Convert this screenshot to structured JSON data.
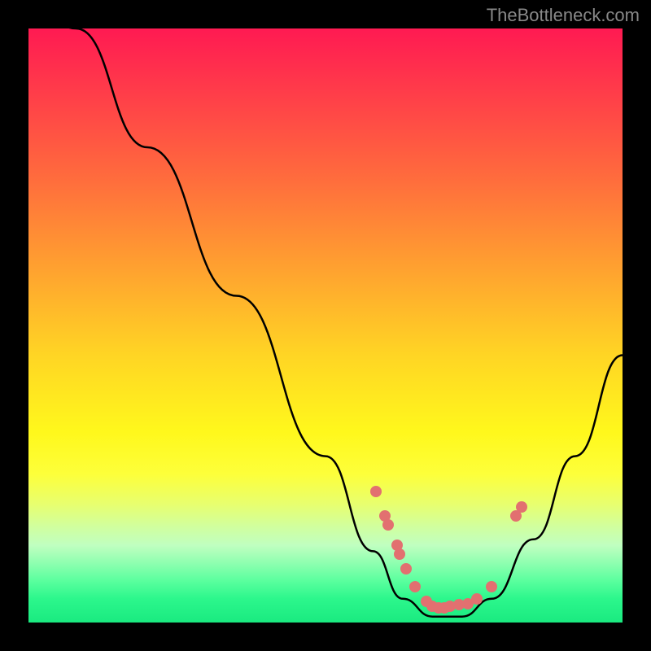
{
  "watermark": "TheBottleneck.com",
  "chart_data": {
    "type": "line",
    "title": "",
    "xlabel": "",
    "ylabel": "",
    "xlim": [
      0,
      100
    ],
    "ylim": [
      0,
      100
    ],
    "background_gradient": {
      "top": "#ff1a52",
      "middle": "#fff81c",
      "bottom": "#1aea80"
    },
    "curve": [
      {
        "x": 0,
        "y": 105
      },
      {
        "x": 8,
        "y": 100
      },
      {
        "x": 20,
        "y": 80
      },
      {
        "x": 35,
        "y": 55
      },
      {
        "x": 50,
        "y": 28
      },
      {
        "x": 58,
        "y": 12
      },
      {
        "x": 63,
        "y": 4
      },
      {
        "x": 68,
        "y": 1
      },
      {
        "x": 73,
        "y": 1
      },
      {
        "x": 78,
        "y": 4
      },
      {
        "x": 85,
        "y": 14
      },
      {
        "x": 92,
        "y": 28
      },
      {
        "x": 100,
        "y": 45
      }
    ],
    "dots": [
      {
        "x": 58.5,
        "y": 22
      },
      {
        "x": 60,
        "y": 18
      },
      {
        "x": 60.5,
        "y": 16.5
      },
      {
        "x": 62,
        "y": 13
      },
      {
        "x": 62.5,
        "y": 11.5
      },
      {
        "x": 63.5,
        "y": 9
      },
      {
        "x": 65,
        "y": 6
      },
      {
        "x": 67,
        "y": 3.5
      },
      {
        "x": 68,
        "y": 2.8
      },
      {
        "x": 69,
        "y": 2.5
      },
      {
        "x": 70,
        "y": 2.4
      },
      {
        "x": 71,
        "y": 2.8
      },
      {
        "x": 72.5,
        "y": 3
      },
      {
        "x": 74,
        "y": 3.2
      },
      {
        "x": 75.5,
        "y": 4
      },
      {
        "x": 78,
        "y": 6
      },
      {
        "x": 82,
        "y": 18
      },
      {
        "x": 83,
        "y": 19.5
      }
    ]
  }
}
